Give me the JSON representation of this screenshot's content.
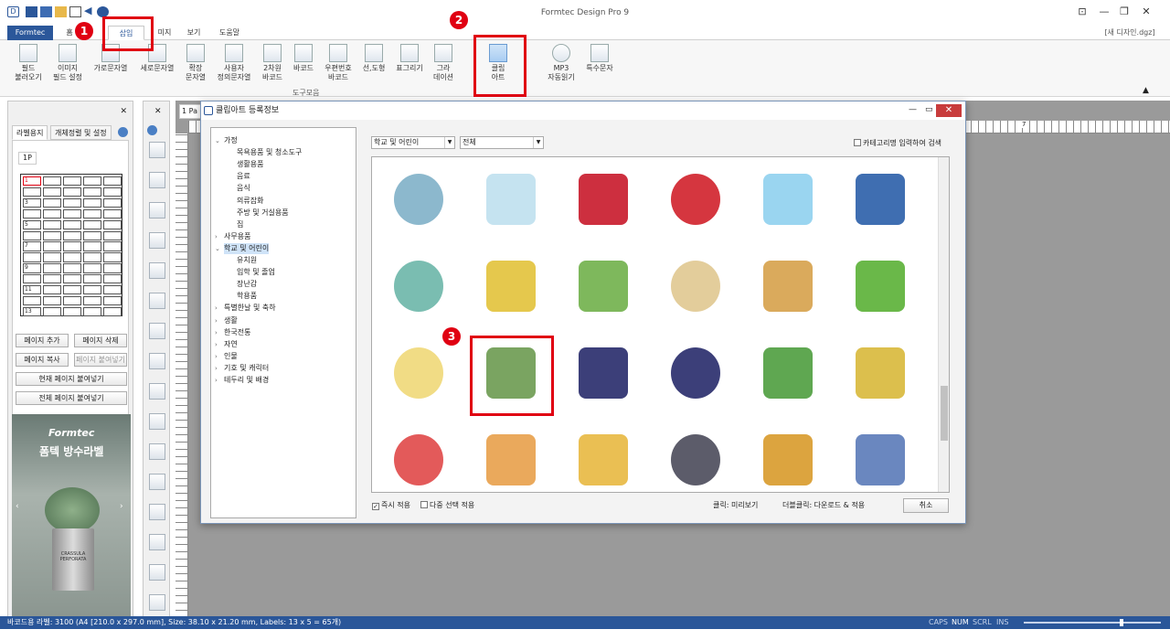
{
  "app": {
    "title": "Formtec Design Pro 9",
    "doc_name": "[새 디자인.dgz]"
  },
  "ribbon_tabs": [
    "Formtec",
    "홈",
    "삽입",
    "미지",
    "보기",
    "도움말"
  ],
  "ribbon": {
    "buttons": [
      "필드\n불러오기",
      "이미지\n필드 설정",
      "가로문자열",
      "세로문자열",
      "확장\n문자열",
      "사용자\n정의문자열",
      "2차원\n바코드",
      "바코드",
      "우편번호\n바코드",
      "선,도형",
      "표그리기",
      "그라\n데이션",
      "클립\n아트",
      "MP3\n자동읽기",
      "특수문자"
    ],
    "group_label": "도구모음"
  },
  "annotations": {
    "one": "1",
    "two": "2",
    "three": "3"
  },
  "left_panel": {
    "tabs": [
      "라벨용지",
      "개체정렬 및 설정"
    ],
    "page_tab": "1P",
    "rows": [
      "1",
      "3",
      "5",
      "7",
      "9",
      "11",
      "13"
    ],
    "buttons": [
      "페이지 추가",
      "페이지 삭제",
      "페이지 복사",
      "페이지 붙여넣기",
      "현재 페이지 붙여넣기",
      "전체 페이지 붙여넣기"
    ],
    "ad_brand": "Formtec",
    "ad_title": "폼텍 방수라벨",
    "ad_pot_label": "CRASSULA\nPERFORATA"
  },
  "canvas": {
    "page_tab": "1 Pa",
    "ruler_num": "7"
  },
  "dialog": {
    "title": "클립아트 등록정보",
    "tree": [
      {
        "label": "가정",
        "level": 0,
        "open": true
      },
      {
        "label": "목욕용품 및 청소도구",
        "level": 1
      },
      {
        "label": "생활용품",
        "level": 1
      },
      {
        "label": "음료",
        "level": 1
      },
      {
        "label": "음식",
        "level": 1
      },
      {
        "label": "의류잡화",
        "level": 1
      },
      {
        "label": "주방 및 거실용품",
        "level": 1
      },
      {
        "label": "집",
        "level": 1
      },
      {
        "label": "사무용품",
        "level": 0,
        "open": false
      },
      {
        "label": "학교 및 어린이",
        "level": 0,
        "open": true,
        "selected": true
      },
      {
        "label": "유치원",
        "level": 1
      },
      {
        "label": "입학 및 졸업",
        "level": 1
      },
      {
        "label": "장난감",
        "level": 1
      },
      {
        "label": "학용품",
        "level": 1
      },
      {
        "label": "특별한날 및 축하",
        "level": 0,
        "open": false
      },
      {
        "label": "생활",
        "level": 0,
        "open": false
      },
      {
        "label": "한국전통",
        "level": 0,
        "open": false
      },
      {
        "label": "자연",
        "level": 0,
        "open": false
      },
      {
        "label": "인물",
        "level": 0,
        "open": false
      },
      {
        "label": "기호 및 캐릭터",
        "level": 0,
        "open": false
      },
      {
        "label": "테두리 및 배경",
        "level": 0,
        "open": false
      }
    ],
    "combo_category": "학교 및 어린이",
    "combo_filter": "전체",
    "search_check": "카테고리명 입력하여 검색",
    "instant_apply": "즉시 적용",
    "multi_select": "다중 선택 적용",
    "hint_click": "클릭: 미리보기",
    "hint_dblclick": "더블클릭: 다운로드 & 적용",
    "cancel": "취소",
    "clipart": [
      "paper-plane",
      "ice-crystal",
      "red-die",
      "dice-pair",
      "bunny",
      "spinning-top",
      "toy-wheel",
      "bunny-balloons",
      "balloon-gift",
      "balloons",
      "bow-arrow",
      "star-pencils",
      "pie-chart-paper",
      "book-pencil",
      "graduation-cap",
      "graduation-cap-dark",
      "backpack",
      "open-book",
      "xylophone",
      "crayon",
      "pencil",
      "pencil-sharpener",
      "globe",
      "bookshelf"
    ]
  },
  "status": {
    "text": "바코드용 라벨: 3100 (A4 [210.0 x 297.0 mm], Size: 38.10 x 21.20 mm,  Labels: 13 x 5 = 65개)",
    "caps": "CAPS",
    "num": "NUM",
    "scrl": "SCRL",
    "ins": "INS"
  }
}
